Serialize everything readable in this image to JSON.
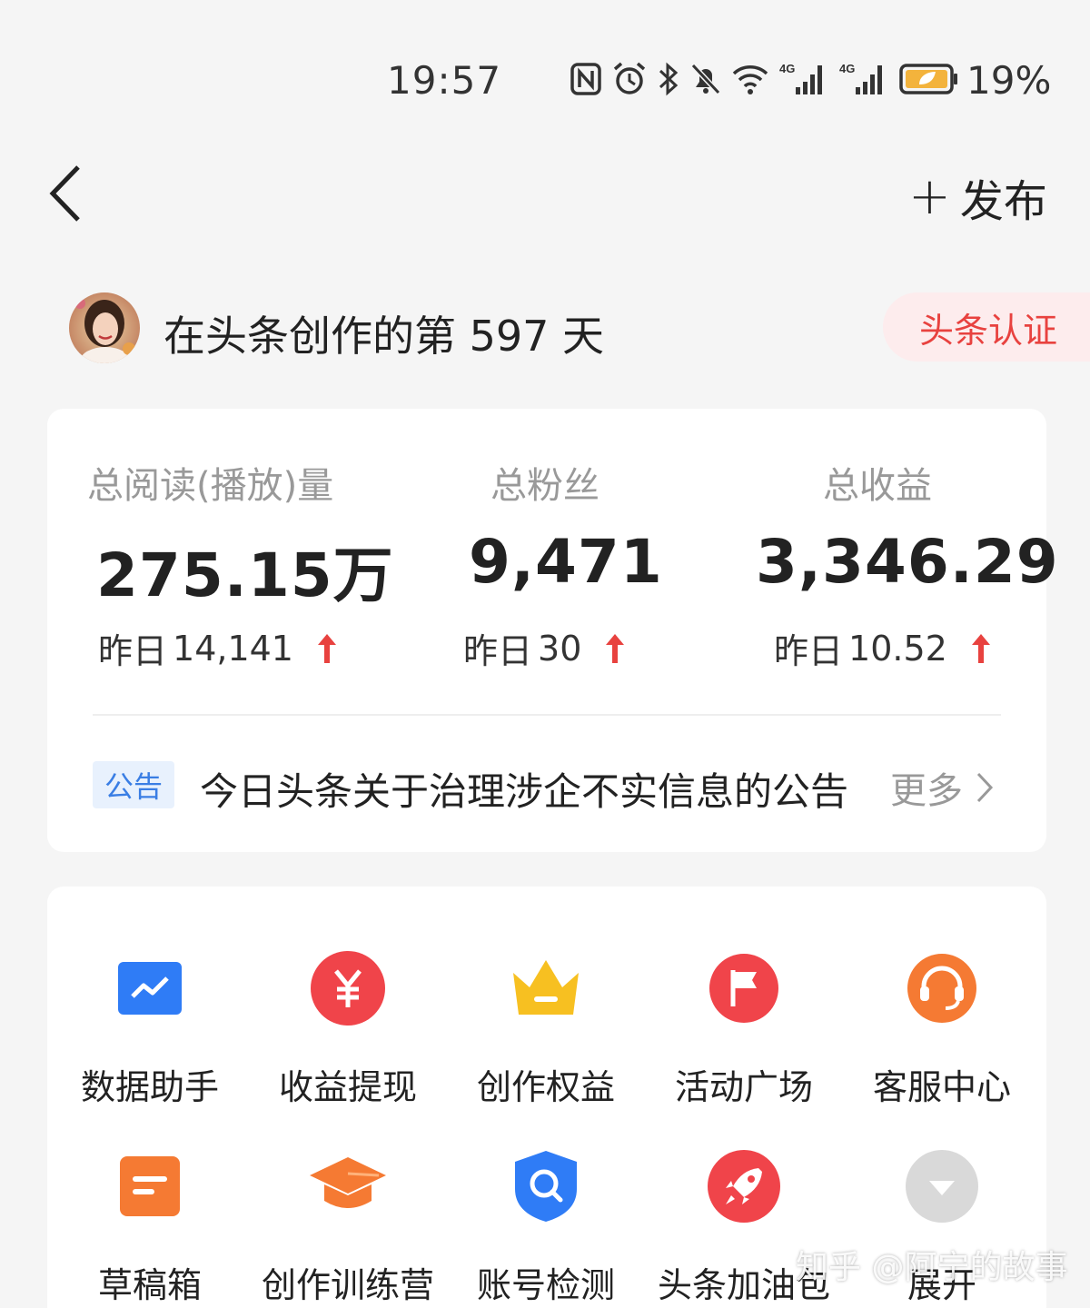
{
  "status_bar": {
    "time": "19:57",
    "battery_percent": "19%",
    "icons": [
      "nfc-icon",
      "alarm-icon",
      "bluetooth-icon",
      "mute-icon",
      "wifi-icon",
      "signal-4g-icon",
      "signal-4g-icon",
      "battery-icon"
    ],
    "network_label": "4G"
  },
  "nav": {
    "back_icon": "chevron-left-icon",
    "publish_label": "发布",
    "publish_icon": "+"
  },
  "profile": {
    "days_text": "在头条创作的第 597 天",
    "cert_label": "头条认证"
  },
  "stats": [
    {
      "label": "总阅读(播放)量",
      "value": "275.15万",
      "yesterday_label": "昨日",
      "yesterday_value": "14,141"
    },
    {
      "label": "总粉丝",
      "value": "9,471",
      "yesterday_label": "昨日",
      "yesterday_value": "30"
    },
    {
      "label": "总收益",
      "value": "3,346.29",
      "yesterday_label": "昨日",
      "yesterday_value": "10.52"
    }
  ],
  "notice": {
    "tag": "公告",
    "text": "今日头条关于治理涉企不实信息的公告",
    "more_label": "更多"
  },
  "tools": [
    {
      "label": "数据助手",
      "icon": "chart-icon"
    },
    {
      "label": "收益提现",
      "icon": "yuan-icon"
    },
    {
      "label": "创作权益",
      "icon": "crown-icon"
    },
    {
      "label": "活动广场",
      "icon": "flag-icon"
    },
    {
      "label": "客服中心",
      "icon": "headset-icon"
    },
    {
      "label": "草稿箱",
      "icon": "draft-icon"
    },
    {
      "label": "创作训练营",
      "icon": "graduation-cap-icon"
    },
    {
      "label": "账号检测",
      "icon": "shield-search-icon"
    },
    {
      "label": "头条加油包",
      "icon": "rocket-icon"
    },
    {
      "label": "展开",
      "icon": "expand-icon"
    }
  ],
  "watermark": "知乎 @阿宁的故事",
  "colors": {
    "accent_red": "#e8423f",
    "accent_blue": "#3a7ee4",
    "background": "#f5f5f5",
    "muted_text": "#999999"
  }
}
